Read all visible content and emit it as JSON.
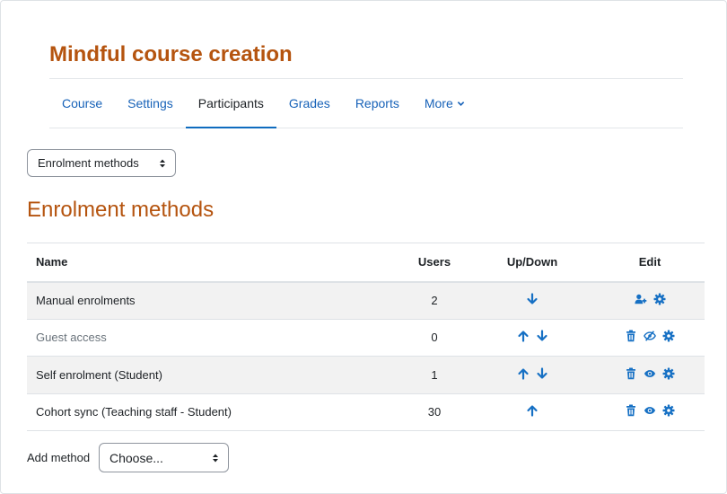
{
  "course": {
    "title": "Mindful course creation"
  },
  "nav": {
    "items": [
      {
        "label": "Course"
      },
      {
        "label": "Settings"
      },
      {
        "label": "Participants",
        "active": true
      },
      {
        "label": "Grades"
      },
      {
        "label": "Reports"
      },
      {
        "label": "More"
      }
    ]
  },
  "page_select": {
    "value": "Enrolment methods"
  },
  "heading": "Enrolment methods",
  "table": {
    "headers": {
      "name": "Name",
      "users": "Users",
      "updown": "Up/Down",
      "edit": "Edit"
    },
    "rows": [
      {
        "name": "Manual enrolments",
        "users": "2",
        "up": false,
        "down": true,
        "edit_icons": [
          "enrol-users-icon",
          "gear-icon"
        ],
        "disabled": false
      },
      {
        "name": "Guest access",
        "users": "0",
        "up": true,
        "down": true,
        "edit_icons": [
          "trash-icon",
          "eye-slash-icon",
          "gear-icon"
        ],
        "disabled": true
      },
      {
        "name": "Self enrolment (Student)",
        "users": "1",
        "up": true,
        "down": true,
        "edit_icons": [
          "trash-icon",
          "eye-icon",
          "gear-icon"
        ],
        "disabled": false
      },
      {
        "name": "Cohort sync (Teaching staff - Student)",
        "users": "30",
        "up": true,
        "down": false,
        "edit_icons": [
          "trash-icon",
          "eye-icon",
          "gear-icon"
        ],
        "disabled": false
      }
    ]
  },
  "add_method": {
    "label": "Add method",
    "value": "Choose..."
  },
  "colors": {
    "accent": "#0f6cbf",
    "link": "#1762b8",
    "title": "#b5540f",
    "icon": "#1670c4"
  }
}
